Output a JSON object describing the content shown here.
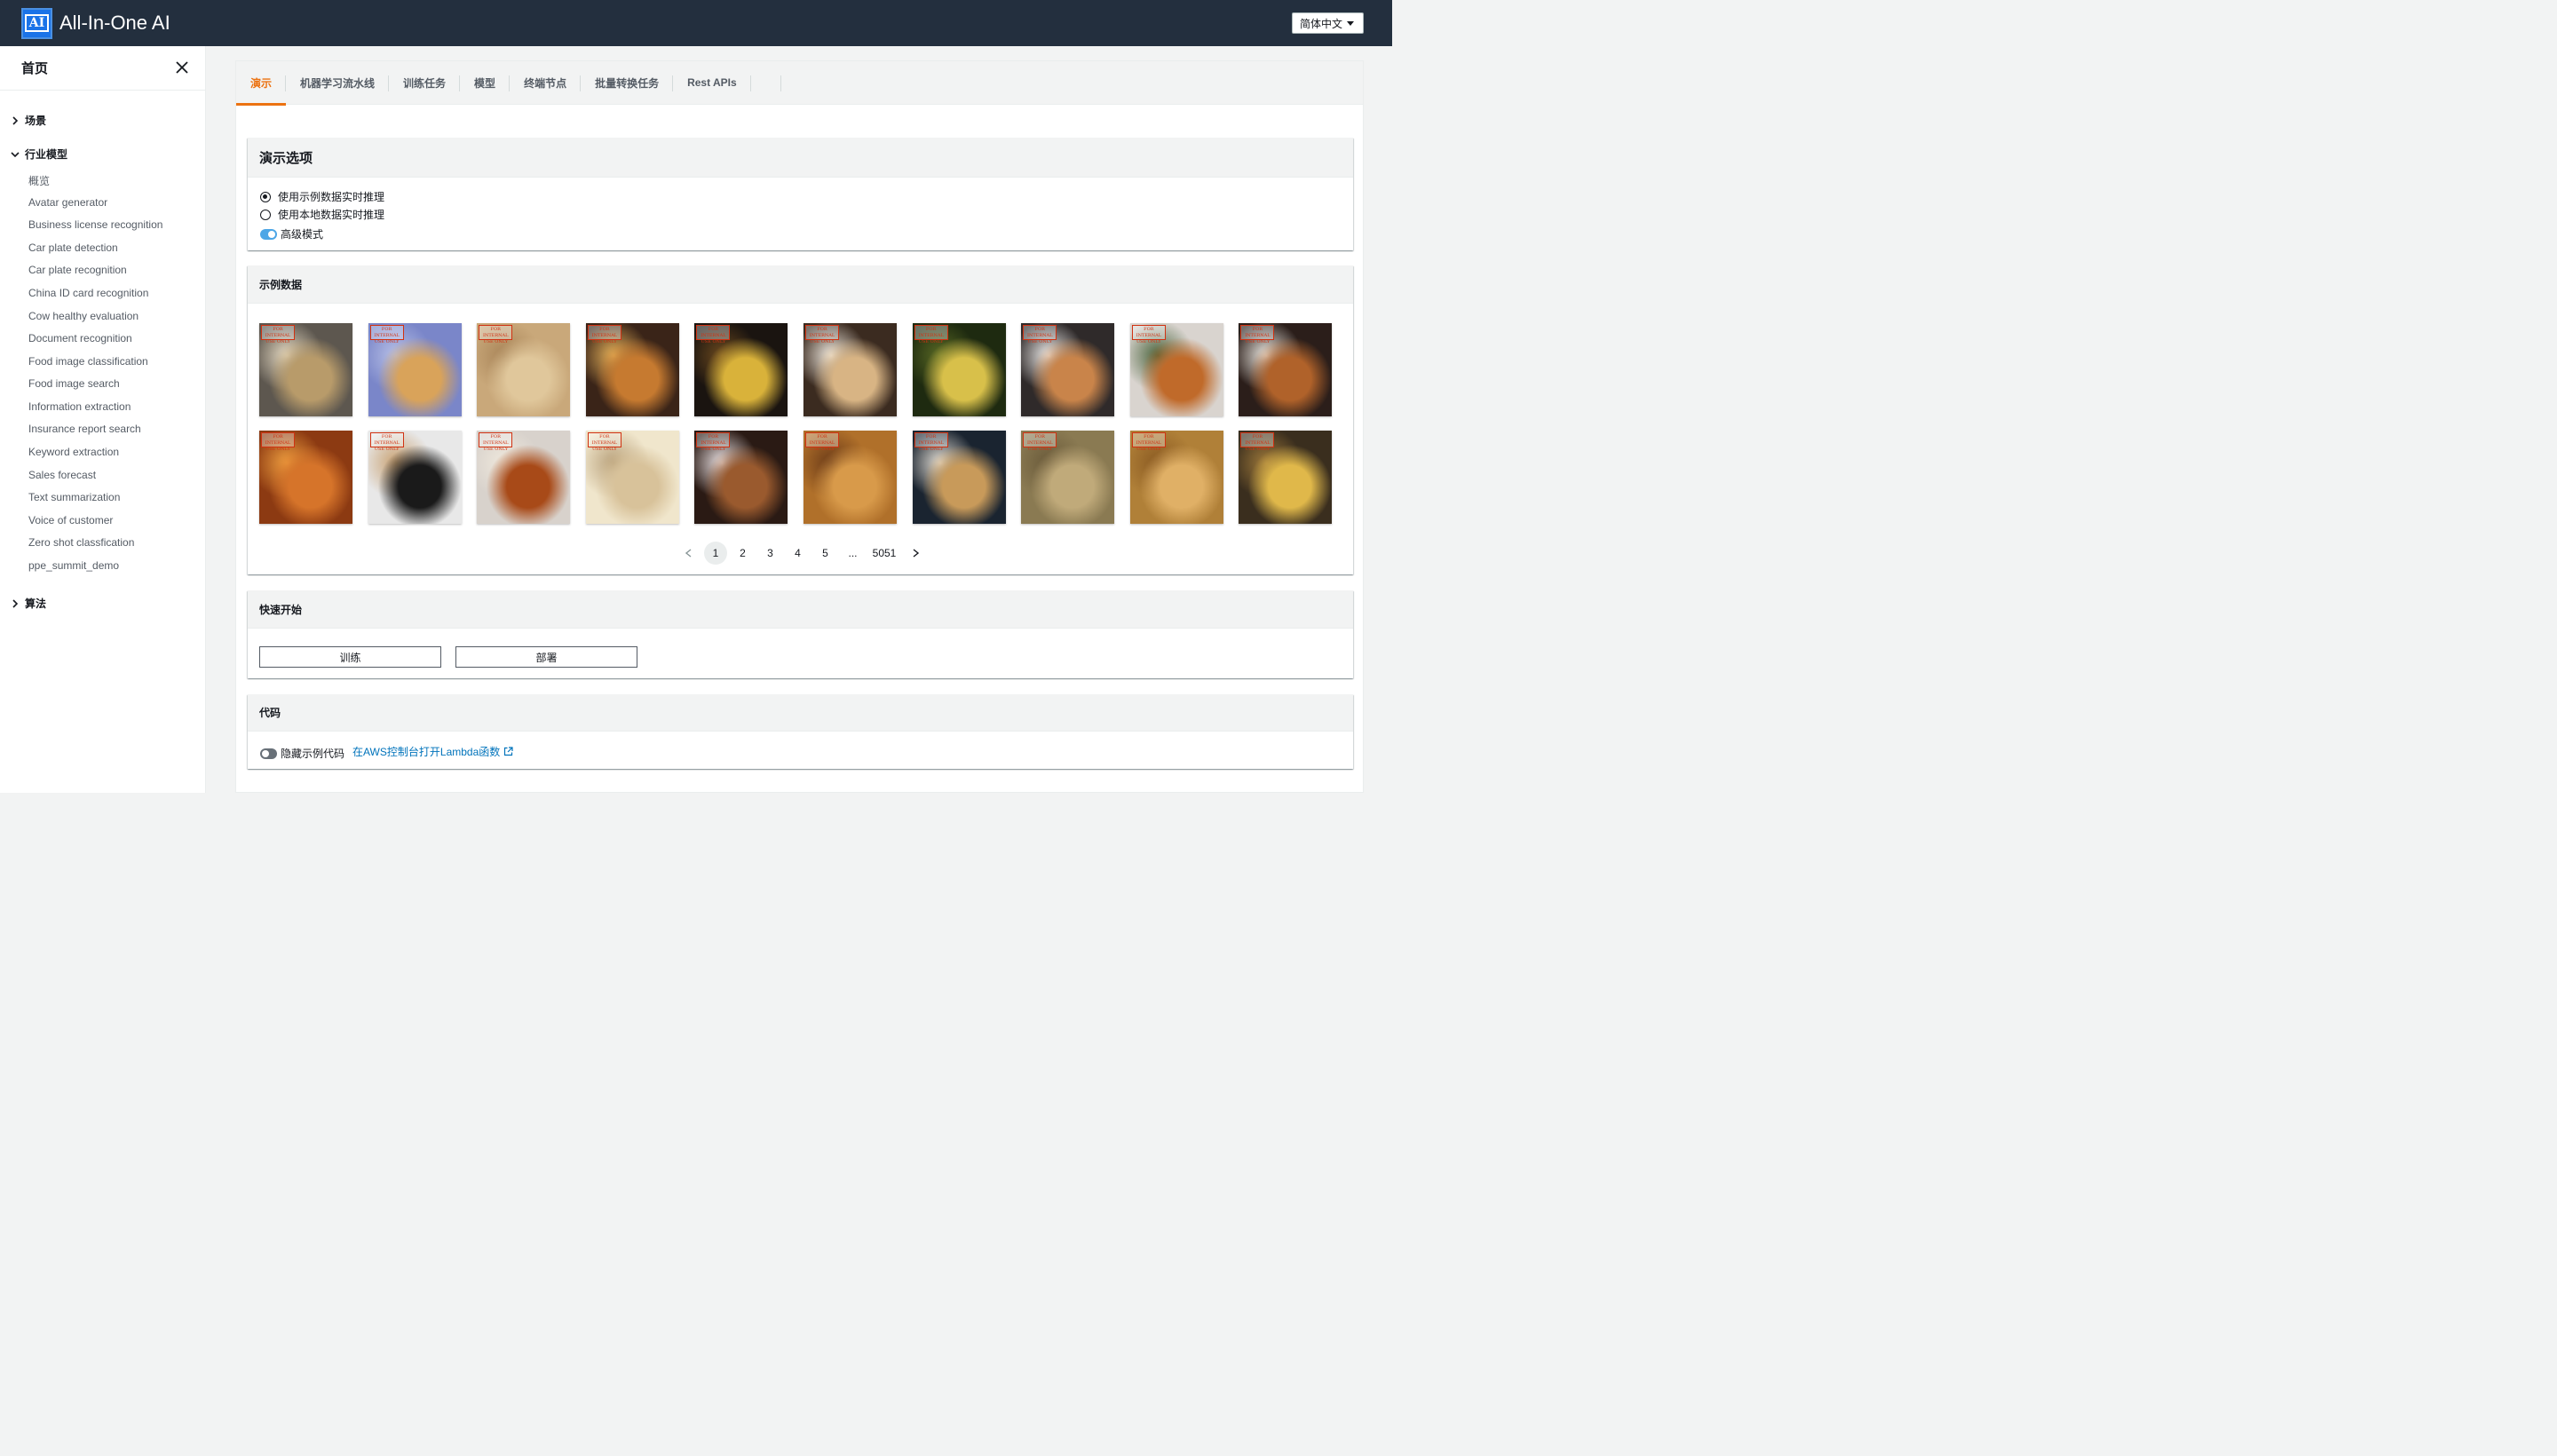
{
  "header": {
    "logo_text": "AI",
    "app_title": "All-In-One AI",
    "language": "简体中文"
  },
  "sidebar": {
    "title": "首页",
    "groups": [
      {
        "label": "场景",
        "expanded": false
      },
      {
        "label": "行业模型",
        "expanded": true
      },
      {
        "label": "算法",
        "expanded": false
      }
    ],
    "items": [
      "概览",
      "Avatar generator",
      "Business license recognition",
      "Car plate detection",
      "Car plate recognition",
      "China ID card recognition",
      "Cow healthy evaluation",
      "Document recognition",
      "Food image classification",
      "Food image search",
      "Information extraction",
      "Insurance report search",
      "Keyword extraction",
      "Sales forecast",
      "Text summarization",
      "Voice of customer",
      "Zero shot classfication",
      "ppe_summit_demo"
    ]
  },
  "tabs": [
    "演示",
    "机器学习流水线",
    "训练任务",
    "模型",
    "终端节点",
    "批量转换任务",
    "Rest APIs"
  ],
  "active_tab": "演示",
  "demo_options": {
    "title": "演示选项",
    "radio_sample": "使用示例数据实时推理",
    "radio_local": "使用本地数据实时推理",
    "advanced_mode": "高级模式",
    "selected": "sample",
    "advanced_on": true
  },
  "sample_data": {
    "title": "示例数据",
    "stamp_text": "FOR INTERNAL USE ONLY",
    "images": [
      {
        "desc": "pie slice on plate",
        "colors": [
          "#5d574f",
          "#b89b6a",
          "#e8dcc4"
        ]
      },
      {
        "desc": "pastry in hand",
        "colors": [
          "#7a86c9",
          "#d9a35a",
          "#b9c1e6"
        ]
      },
      {
        "desc": "whole pie top",
        "colors": [
          "#c9a87a",
          "#e0c79b",
          "#a88458"
        ]
      },
      {
        "desc": "apple crisp jar",
        "colors": [
          "#3a2418",
          "#c67a30",
          "#e6b25a"
        ]
      },
      {
        "desc": "dessert with strawberry",
        "colors": [
          "#1a1410",
          "#d9b23a",
          "#6d4a1e"
        ]
      },
      {
        "desc": "pie with whipped cream",
        "colors": [
          "#3b2b20",
          "#d8b484",
          "#f2ece2"
        ]
      },
      {
        "desc": "cheese dessert dark",
        "colors": [
          "#1e2a10",
          "#d8c04a",
          "#5a6a24"
        ]
      },
      {
        "desc": "pie with cream slice",
        "colors": [
          "#2f2a2a",
          "#c9844a",
          "#f2f0ee"
        ]
      },
      {
        "desc": "apple pie ice cream",
        "colors": [
          "#d9d4cf",
          "#c06a2a",
          "#48623a"
        ]
      },
      {
        "desc": "waffle ice cream",
        "colors": [
          "#2b1e1a",
          "#b0622a",
          "#f0ede6"
        ]
      },
      {
        "desc": "caramel apple closeup",
        "colors": [
          "#8c3a12",
          "#d6742a",
          "#f0a040"
        ]
      },
      {
        "desc": "chef holding pie",
        "colors": [
          "#e8e8e8",
          "#1a1a1a",
          "#c8a070"
        ]
      },
      {
        "desc": "pie and ice cream",
        "colors": [
          "#d8d2cc",
          "#a84a18",
          "#efe8dc"
        ]
      },
      {
        "desc": "decorated pie top",
        "colors": [
          "#f0e6cc",
          "#d8c29a",
          "#b8a07a"
        ]
      },
      {
        "desc": "pastry box dessert",
        "colors": [
          "#2a1a14",
          "#9a5a2e",
          "#f0e8ea"
        ]
      },
      {
        "desc": "lattice pie",
        "colors": [
          "#b0702a",
          "#d89a4a",
          "#6a3a18"
        ]
      },
      {
        "desc": "pie slice dark background",
        "colors": [
          "#1a2430",
          "#c89a5a",
          "#e8e2d8"
        ]
      },
      {
        "desc": "crumble top",
        "colors": [
          "#8a7a52",
          "#c0aa7a",
          "#6a5a3a"
        ]
      },
      {
        "desc": "golden pie",
        "colors": [
          "#b08038",
          "#e0b066",
          "#8a5a22"
        ]
      },
      {
        "desc": "custard dessert",
        "colors": [
          "#3a2e1e",
          "#e0b84a",
          "#a07a3a"
        ]
      }
    ],
    "pagination": {
      "pages": [
        "1",
        "2",
        "3",
        "4",
        "5",
        "...",
        "5051"
      ],
      "current": "1"
    }
  },
  "quick_start": {
    "title": "快速开始",
    "train_label": "训练",
    "deploy_label": "部署"
  },
  "code": {
    "title": "代码",
    "hide_label": "隐藏示例代码",
    "hide_on": false,
    "lambda_link": "在AWS控制台打开Lambda函数"
  },
  "colors": {
    "header_bg": "#232f3e",
    "active_tab": "#ec7211",
    "link": "#0073bb",
    "toggle_on": "#4da6e6"
  }
}
